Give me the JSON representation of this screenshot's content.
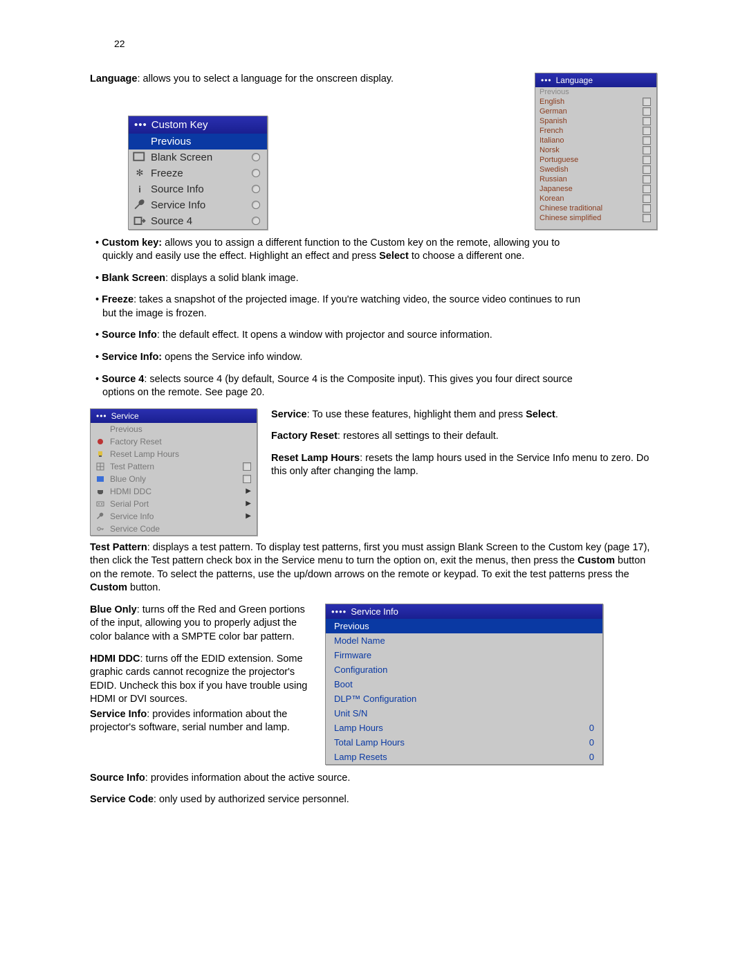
{
  "page_number": "22",
  "intro_language": {
    "label": "Language",
    "text": ": allows you to select a language for the onscreen display."
  },
  "custom_key_menu": {
    "title": "Custom Key",
    "items": [
      "Previous",
      "Blank Screen",
      "Freeze",
      "Source Info",
      "Service Info",
      "Source 4"
    ]
  },
  "language_menu": {
    "title": "Language",
    "items": [
      "Previous",
      "English",
      "German",
      "Spanish",
      "French",
      "Italiano",
      "Norsk",
      "Portuguese",
      "Swedish",
      "Russian",
      "Japanese",
      "Korean",
      "Chinese traditional",
      "Chinese simplified"
    ]
  },
  "bullets": {
    "custom_key": {
      "label": "Custom key:",
      "text": " allows you to assign a different function to the Custom key on the remote, allowing you to quickly and easily use the effect. Highlight an effect and press ",
      "select": "Select",
      "tail": " to choose a different one."
    },
    "blank_screen": {
      "label": "Blank Screen",
      "text": ": displays a solid blank image."
    },
    "freeze": {
      "label": "Freeze",
      "text": ": takes a snapshot of the projected image. If you're watching video, the source video continues to run but the image is frozen."
    },
    "source_info": {
      "label": "Source Info",
      "text": ": the default effect. It opens a window with projector and source information."
    },
    "service_info": {
      "label": "Service Info:",
      "text": " opens the Service info window."
    },
    "source4": {
      "label": "Source 4",
      "text": ": selects source 4 (by default, Source 4 is the Composite input). This gives you four direct source options on the remote. See page 20."
    }
  },
  "service_intro": {
    "label": "Service",
    "text": ": To use these features, highlight them and press ",
    "select": "Select",
    "period": "."
  },
  "factory_reset": {
    "label": "Factory Reset",
    "text": ": restores all settings to their default."
  },
  "reset_lamp": {
    "label": "Reset Lamp Hours",
    "text": ": resets the lamp hours used in the Service Info menu to zero. Do this only after changing the lamp."
  },
  "service_menu": {
    "title": "Service",
    "items": [
      "Previous",
      "Factory Reset",
      "Reset Lamp Hours",
      "Test Pattern",
      "Blue Only",
      "HDMI DDC",
      "Serial Port",
      "Service Info",
      "Service Code"
    ]
  },
  "test_pattern": {
    "label": "Test Pattern",
    "pre": ": displays a test pattern. To display test patterns, first you must assign Blank Screen to the Custom key (page 17), then click the Test pattern check box in the Service menu to turn the option on, exit the menus, then press the ",
    "custom1": "Custom",
    "mid": " button on the remote. To select the patterns, use the up/down arrows on the remote or keypad. To exit the test patterns press the ",
    "custom2": "Custom",
    "tail": " button."
  },
  "blue_only": {
    "label": "Blue Only",
    "text": ": turns off the Red and Green portions of the input, allowing you to properly adjust the color balance with a SMPTE color bar pattern."
  },
  "hdmi_ddc": {
    "label": "HDMI DDC",
    "text": ": turns off the EDID extension. Some graphic cards cannot recognize the projector's EDID. Uncheck this box if you have trouble using HDMI or DVI sources."
  },
  "service_info2": {
    "label": "Service Info",
    "text": ": provides information about the projector's software, serial number and lamp."
  },
  "service_info_menu": {
    "title": "Service Info",
    "items": [
      {
        "label": "Previous",
        "val": ""
      },
      {
        "label": "Model Name",
        "val": ""
      },
      {
        "label": "Firmware",
        "val": ""
      },
      {
        "label": "Configuration",
        "val": ""
      },
      {
        "label": "Boot",
        "val": ""
      },
      {
        "label": "DLP™ Configuration",
        "val": ""
      },
      {
        "label": "Unit S/N",
        "val": ""
      },
      {
        "label": "Lamp Hours",
        "val": "0"
      },
      {
        "label": "Total Lamp Hours",
        "val": "0"
      },
      {
        "label": "Lamp Resets",
        "val": "0"
      }
    ]
  },
  "source_info2": {
    "label": "Source Info",
    "text": ": provides information about the active source."
  },
  "service_code": {
    "label": "Service Code",
    "text": ": only used by authorized service personnel."
  }
}
